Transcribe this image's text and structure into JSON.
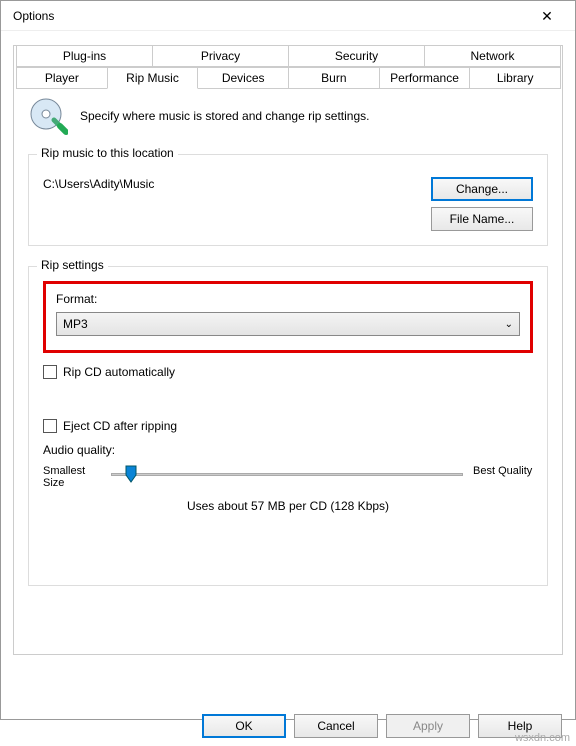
{
  "window": {
    "title": "Options"
  },
  "tabs_row1": {
    "t0": "Plug-ins",
    "t1": "Privacy",
    "t2": "Security",
    "t3": "Network"
  },
  "tabs_row2": {
    "t0": "Player",
    "t1": "Rip Music",
    "t2": "Devices",
    "t3": "Burn",
    "t4": "Performance",
    "t5": "Library"
  },
  "header": {
    "text": "Specify where music is stored and change rip settings."
  },
  "location": {
    "legend": "Rip music to this location",
    "path": "C:\\Users\\Adity\\Music",
    "change_btn": "Change...",
    "filename_btn": "File Name..."
  },
  "settings": {
    "legend": "Rip settings",
    "format_label": "Format:",
    "format_value": "MP3",
    "rip_auto": "Rip CD automatically",
    "eject": "Eject CD after ripping",
    "quality_label": "Audio quality:",
    "smallest": "Smallest Size",
    "best": "Best Quality",
    "usage": "Uses about 57 MB per CD (128 Kbps)"
  },
  "buttons": {
    "ok": "OK",
    "cancel": "Cancel",
    "apply": "Apply",
    "help": "Help"
  },
  "watermark": "wsxdn.com"
}
